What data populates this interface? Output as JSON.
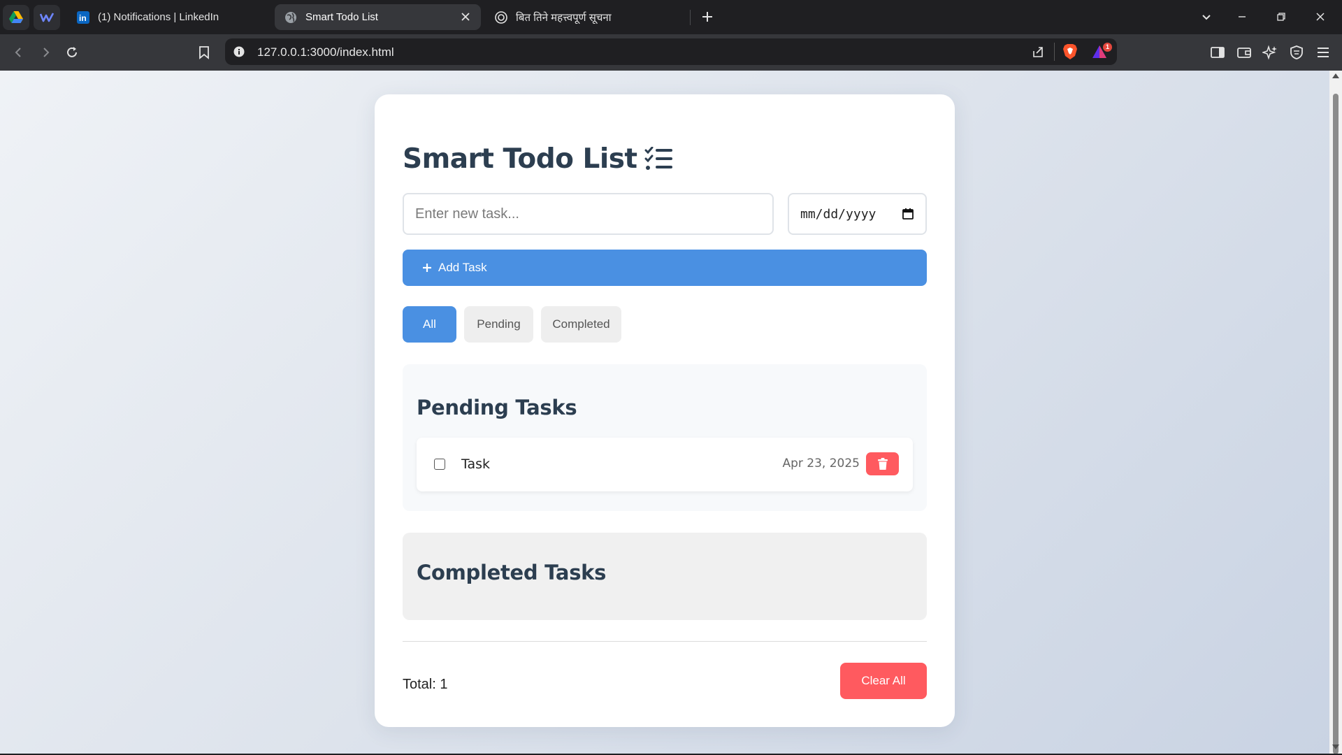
{
  "browser": {
    "tabs": [
      {
        "title": "(1) Notifications | LinkedIn",
        "icon": "linkedin-icon",
        "active": false
      },
      {
        "title": "Smart Todo List",
        "icon": "globe-icon",
        "active": true
      },
      {
        "title": "बित तिने महत्त्वपूर्ण सूचना",
        "icon": "openai-icon",
        "active": false
      }
    ],
    "url": "127.0.0.1:3000/index.html",
    "notification_count": "1",
    "colors": {
      "tabbar": "#1f1f22",
      "toolbar": "#36373b",
      "brave_orange": "#fb542b"
    }
  },
  "app": {
    "title": "Smart Todo List",
    "title_icon": "checklist-icon",
    "task_input_placeholder": "Enter new task...",
    "date_placeholder": "mm/dd/yyyy",
    "add_button_label": "Add Task",
    "filters": [
      {
        "label": "All",
        "active": true
      },
      {
        "label": "Pending",
        "active": false
      },
      {
        "label": "Completed",
        "active": false
      }
    ],
    "pending_heading": "Pending Tasks",
    "pending_tasks": [
      {
        "text": "Task",
        "date": "Apr 23, 2025",
        "completed": false
      }
    ],
    "completed_heading": "Completed Tasks",
    "completed_tasks": [],
    "total_label": "Total: 1",
    "clear_button_label": "Clear All",
    "colors": {
      "primary": "#4a90e2",
      "danger": "#ff5a5f",
      "heading": "#2c3e50"
    }
  }
}
